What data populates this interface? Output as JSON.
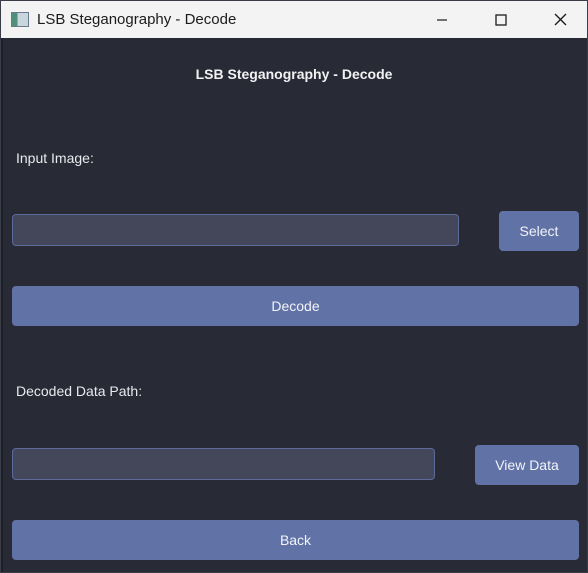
{
  "window": {
    "title": "LSB Steganography - Decode",
    "controls": {
      "minimize_icon": "minimize-icon",
      "maximize_icon": "maximize-icon",
      "close_icon": "close-icon"
    }
  },
  "main": {
    "heading": "LSB Steganography - Decode",
    "input_image_label": "Input Image:",
    "input_image_value": "",
    "select_button": "Select",
    "decode_button": "Decode",
    "decoded_path_label": "Decoded Data Path:",
    "decoded_path_value": "",
    "view_data_button": "View Data",
    "back_button": "Back"
  },
  "colors": {
    "background": "#282a36",
    "field": "#444759",
    "field_border": "#5c6a9c",
    "button": "#6072a6",
    "titlebar": "#f3f3f3"
  }
}
